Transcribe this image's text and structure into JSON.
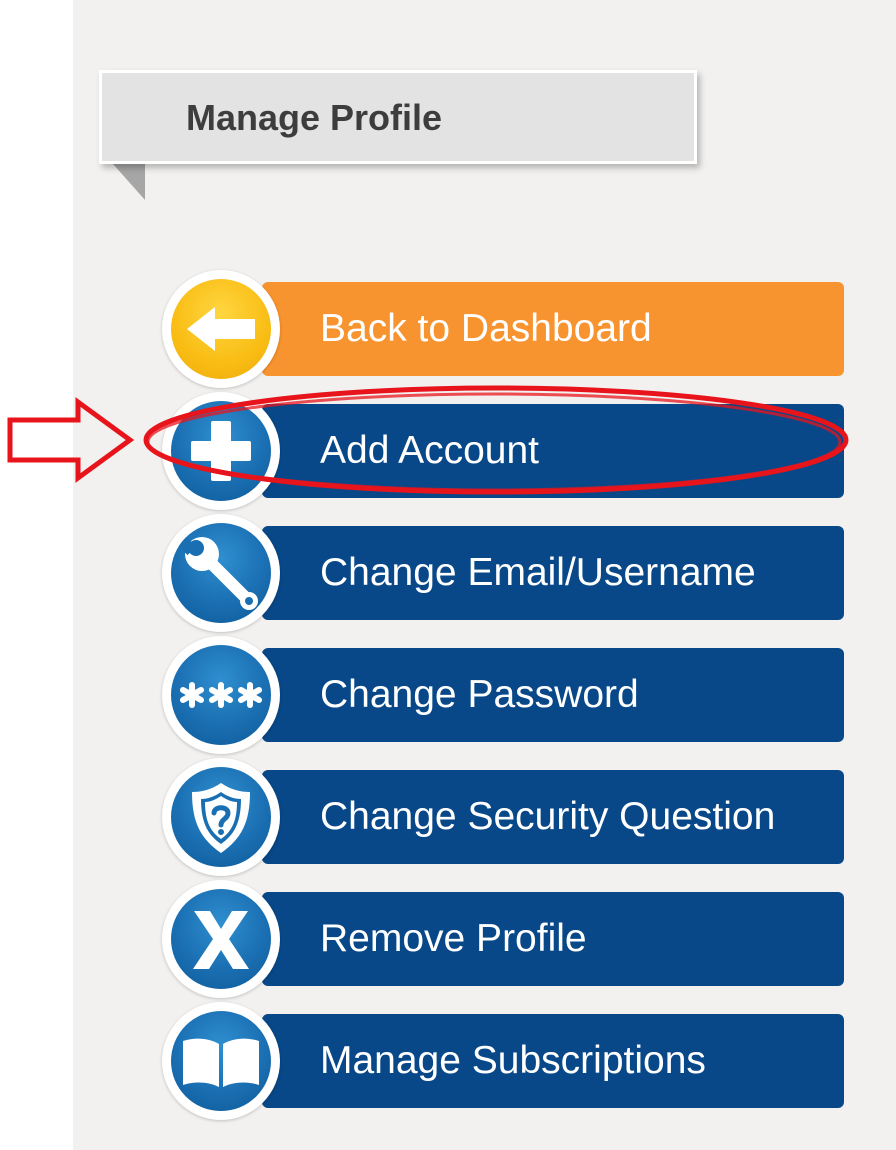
{
  "header": {
    "title": "Manage Profile"
  },
  "menu": {
    "items": [
      {
        "label": "Back to Dashboard",
        "icon": "arrow-left-icon"
      },
      {
        "label": "Add Account",
        "icon": "plus-icon"
      },
      {
        "label": "Change Email/Username",
        "icon": "wrench-icon"
      },
      {
        "label": "Change Password",
        "icon": "asterisks-icon"
      },
      {
        "label": "Change Security Question",
        "icon": "shield-question-icon"
      },
      {
        "label": "Remove Profile",
        "icon": "x-icon"
      },
      {
        "label": "Manage Subscriptions",
        "icon": "book-icon"
      }
    ]
  },
  "colors": {
    "panel_bg": "#f2f1ef",
    "header_box": "#e3e3e3",
    "orange": "#f7942f",
    "navy": "#084888",
    "icon_blue": "#1a6fb2",
    "icon_yellow": "#f9bd14",
    "annotation_red": "#e8141c"
  },
  "annotation": {
    "highlighted_item": "Add Account"
  }
}
